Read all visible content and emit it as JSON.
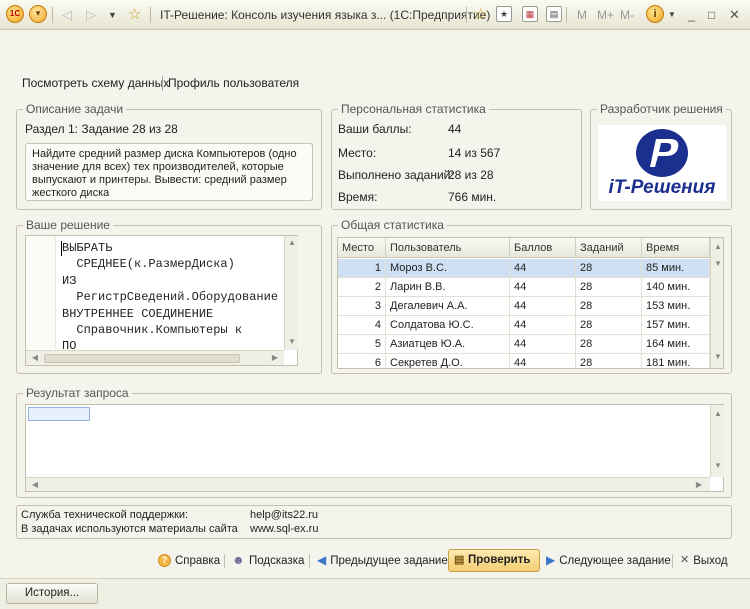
{
  "window": {
    "title": "IT-Решение: Консоль изучения языка з...  (1С:Предприятие)",
    "toolbar_m": "M",
    "toolbar_mplus": "M+",
    "toolbar_mminus": "M-"
  },
  "links": {
    "schema": "Посмотреть схему данных",
    "profile": "Профиль пользователя"
  },
  "task": {
    "group_title": "Описание задачи",
    "section": "Раздел 1: Задание 28 из 28",
    "description": "Найдите средний размер диска Компьютеров (одно значение для всех) тех производителей, которые выпускают и принтеры. Вывести: средний размер жесткого диска"
  },
  "personal": {
    "group_title": "Персональная статистика",
    "rows": [
      {
        "label": "Ваши баллы:",
        "value": "44"
      },
      {
        "label": "Место:",
        "value": "14 из 567"
      },
      {
        "label": "Выполнено заданий:",
        "value": "28 из 28"
      },
      {
        "label": "Время:",
        "value": "766 мин."
      }
    ]
  },
  "developer": {
    "group_title": "Разработчик решения",
    "logo_text": "iT-Решения"
  },
  "solution": {
    "group_title": "Ваше решение",
    "code": "ВЫБРАТЬ\n  СРЕДНЕЕ(к.РазмерДиска)\nИЗ\n  РегистрСведений.Оборудование\nВНУТРЕННЕЕ СОЕДИНЕНИЕ\n  Справочник.Компьютеры к\nПО"
  },
  "stats": {
    "group_title": "Общая статистика",
    "columns": [
      "Место",
      "Пользователь",
      "Баллов",
      "Заданий",
      "Время"
    ],
    "rows": [
      [
        "1",
        "Мороз В.С.",
        "44",
        "28",
        "85 мин."
      ],
      [
        "2",
        "Ларин В.В.",
        "44",
        "28",
        "140 мин."
      ],
      [
        "3",
        "Дегалевич А.А.",
        "44",
        "28",
        "153 мин."
      ],
      [
        "4",
        "Солдатова Ю.С.",
        "44",
        "28",
        "157 мин."
      ],
      [
        "5",
        "Азиатцев Ю.А.",
        "44",
        "28",
        "164 мин."
      ],
      [
        "6",
        "Секретев Д.О.",
        "44",
        "28",
        "181 мин."
      ]
    ]
  },
  "result": {
    "group_title": "Результат запроса"
  },
  "support": {
    "line1_label": "Служба технической поддержки:",
    "line1_value": "help@its22.ru",
    "line2_label": "В задачах используются материалы сайта",
    "line2_value": "www.sql-ex.ru"
  },
  "buttons": {
    "help": "Справка",
    "hint": "Подсказка",
    "prev": "Предыдущее задание",
    "check": "Проверить",
    "next": "Следующее задание",
    "exit": "Выход",
    "history": "История..."
  },
  "colors": {
    "accent": "#f4cf72",
    "logo_blue": "#1b2f8f",
    "selection": "#cfe0f4"
  }
}
